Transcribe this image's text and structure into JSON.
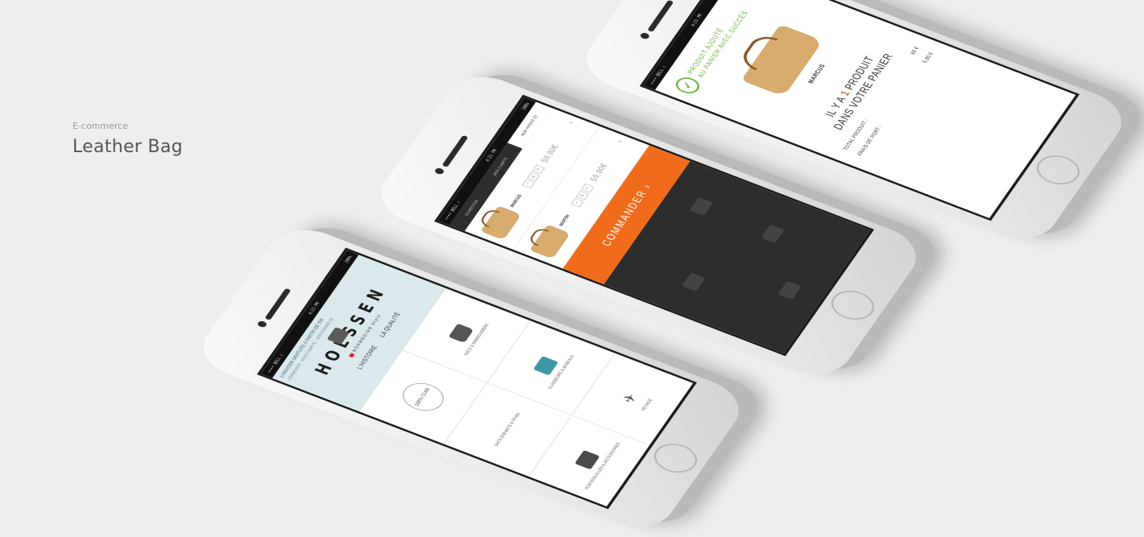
{
  "caption": {
    "kicker": "E-commerce",
    "title": "Leather Bag"
  },
  "status": {
    "carrier": "•••• BELL ⇪",
    "time": "4:21 PM",
    "battery": "100%"
  },
  "phone_home": {
    "shipping_banner": "LIVRAISON GRATUITE À PARTIR DE 50€",
    "nav": [
      "CONNEXION",
      "MON COMPTE",
      "MON PANIER (0)"
    ],
    "brand": "HOLSSEN",
    "brand_sub": "NORWEGIAN Style",
    "links": [
      "L'HISTOIRE",
      "LA QUALITÉ"
    ],
    "seal": "100% CUIR",
    "categories": [
      "SACS & SANDOUSIÈRE",
      "SACS ENFANTS & FRAIS",
      "CLASSEURS & ANNEAUX",
      "PORTEFEUILLES & ACCESSOIRES",
      "VOYAGE"
    ]
  },
  "phone_cart": {
    "tabs": [
      "CONNEXION",
      "MON COMPTE",
      "MON PANIER (0)"
    ],
    "items": [
      {
        "name": "MARCUS",
        "qty": [
          "−",
          "1",
          "+"
        ],
        "price": "59,90€"
      },
      {
        "name": "MARTIN",
        "qty": [
          "−",
          "1",
          "+"
        ],
        "price": "59,90€"
      }
    ],
    "cta": "COMMANDER ›"
  },
  "phone_added": {
    "message_1": "PRODUIT AJOUTÉ",
    "message_2": "AU PANIER AVEC SUCCÈS",
    "product": "MARCUS",
    "count_pre": "IL Y A ",
    "count_num": "1",
    "count_post": " PRODUIT",
    "count_line2": "DANS VOTRE PANIER",
    "total_label": "TOTAL PRODUIT :",
    "total_value": "60 €",
    "shipping_label": "FRAIS DE PORT :",
    "shipping_value": "5,90 €"
  }
}
